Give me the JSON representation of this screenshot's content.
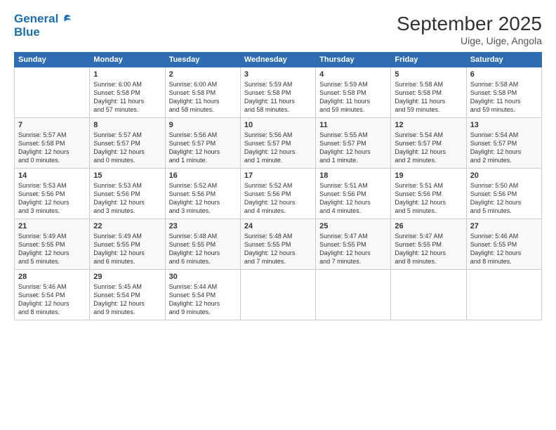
{
  "header": {
    "logo_line1": "General",
    "logo_line2": "Blue",
    "month": "September 2025",
    "location": "Uige, Uige, Angola"
  },
  "days_of_week": [
    "Sunday",
    "Monday",
    "Tuesday",
    "Wednesday",
    "Thursday",
    "Friday",
    "Saturday"
  ],
  "weeks": [
    [
      {
        "day": "",
        "info": ""
      },
      {
        "day": "1",
        "info": "Sunrise: 6:00 AM\nSunset: 5:58 PM\nDaylight: 11 hours\nand 57 minutes."
      },
      {
        "day": "2",
        "info": "Sunrise: 6:00 AM\nSunset: 5:58 PM\nDaylight: 11 hours\nand 58 minutes."
      },
      {
        "day": "3",
        "info": "Sunrise: 5:59 AM\nSunset: 5:58 PM\nDaylight: 11 hours\nand 58 minutes."
      },
      {
        "day": "4",
        "info": "Sunrise: 5:59 AM\nSunset: 5:58 PM\nDaylight: 11 hours\nand 59 minutes."
      },
      {
        "day": "5",
        "info": "Sunrise: 5:58 AM\nSunset: 5:58 PM\nDaylight: 11 hours\nand 59 minutes."
      },
      {
        "day": "6",
        "info": "Sunrise: 5:58 AM\nSunset: 5:58 PM\nDaylight: 11 hours\nand 59 minutes."
      }
    ],
    [
      {
        "day": "7",
        "info": "Sunrise: 5:57 AM\nSunset: 5:58 PM\nDaylight: 12 hours\nand 0 minutes."
      },
      {
        "day": "8",
        "info": "Sunrise: 5:57 AM\nSunset: 5:57 PM\nDaylight: 12 hours\nand 0 minutes."
      },
      {
        "day": "9",
        "info": "Sunrise: 5:56 AM\nSunset: 5:57 PM\nDaylight: 12 hours\nand 1 minute."
      },
      {
        "day": "10",
        "info": "Sunrise: 5:56 AM\nSunset: 5:57 PM\nDaylight: 12 hours\nand 1 minute."
      },
      {
        "day": "11",
        "info": "Sunrise: 5:55 AM\nSunset: 5:57 PM\nDaylight: 12 hours\nand 1 minute."
      },
      {
        "day": "12",
        "info": "Sunrise: 5:54 AM\nSunset: 5:57 PM\nDaylight: 12 hours\nand 2 minutes."
      },
      {
        "day": "13",
        "info": "Sunrise: 5:54 AM\nSunset: 5:57 PM\nDaylight: 12 hours\nand 2 minutes."
      }
    ],
    [
      {
        "day": "14",
        "info": "Sunrise: 5:53 AM\nSunset: 5:56 PM\nDaylight: 12 hours\nand 3 minutes."
      },
      {
        "day": "15",
        "info": "Sunrise: 5:53 AM\nSunset: 5:56 PM\nDaylight: 12 hours\nand 3 minutes."
      },
      {
        "day": "16",
        "info": "Sunrise: 5:52 AM\nSunset: 5:56 PM\nDaylight: 12 hours\nand 3 minutes."
      },
      {
        "day": "17",
        "info": "Sunrise: 5:52 AM\nSunset: 5:56 PM\nDaylight: 12 hours\nand 4 minutes."
      },
      {
        "day": "18",
        "info": "Sunrise: 5:51 AM\nSunset: 5:56 PM\nDaylight: 12 hours\nand 4 minutes."
      },
      {
        "day": "19",
        "info": "Sunrise: 5:51 AM\nSunset: 5:56 PM\nDaylight: 12 hours\nand 5 minutes."
      },
      {
        "day": "20",
        "info": "Sunrise: 5:50 AM\nSunset: 5:56 PM\nDaylight: 12 hours\nand 5 minutes."
      }
    ],
    [
      {
        "day": "21",
        "info": "Sunrise: 5:49 AM\nSunset: 5:55 PM\nDaylight: 12 hours\nand 5 minutes."
      },
      {
        "day": "22",
        "info": "Sunrise: 5:49 AM\nSunset: 5:55 PM\nDaylight: 12 hours\nand 6 minutes."
      },
      {
        "day": "23",
        "info": "Sunrise: 5:48 AM\nSunset: 5:55 PM\nDaylight: 12 hours\nand 6 minutes."
      },
      {
        "day": "24",
        "info": "Sunrise: 5:48 AM\nSunset: 5:55 PM\nDaylight: 12 hours\nand 7 minutes."
      },
      {
        "day": "25",
        "info": "Sunrise: 5:47 AM\nSunset: 5:55 PM\nDaylight: 12 hours\nand 7 minutes."
      },
      {
        "day": "26",
        "info": "Sunrise: 5:47 AM\nSunset: 5:55 PM\nDaylight: 12 hours\nand 8 minutes."
      },
      {
        "day": "27",
        "info": "Sunrise: 5:46 AM\nSunset: 5:55 PM\nDaylight: 12 hours\nand 8 minutes."
      }
    ],
    [
      {
        "day": "28",
        "info": "Sunrise: 5:46 AM\nSunset: 5:54 PM\nDaylight: 12 hours\nand 8 minutes."
      },
      {
        "day": "29",
        "info": "Sunrise: 5:45 AM\nSunset: 5:54 PM\nDaylight: 12 hours\nand 9 minutes."
      },
      {
        "day": "30",
        "info": "Sunrise: 5:44 AM\nSunset: 5:54 PM\nDaylight: 12 hours\nand 9 minutes."
      },
      {
        "day": "",
        "info": ""
      },
      {
        "day": "",
        "info": ""
      },
      {
        "day": "",
        "info": ""
      },
      {
        "day": "",
        "info": ""
      }
    ]
  ]
}
